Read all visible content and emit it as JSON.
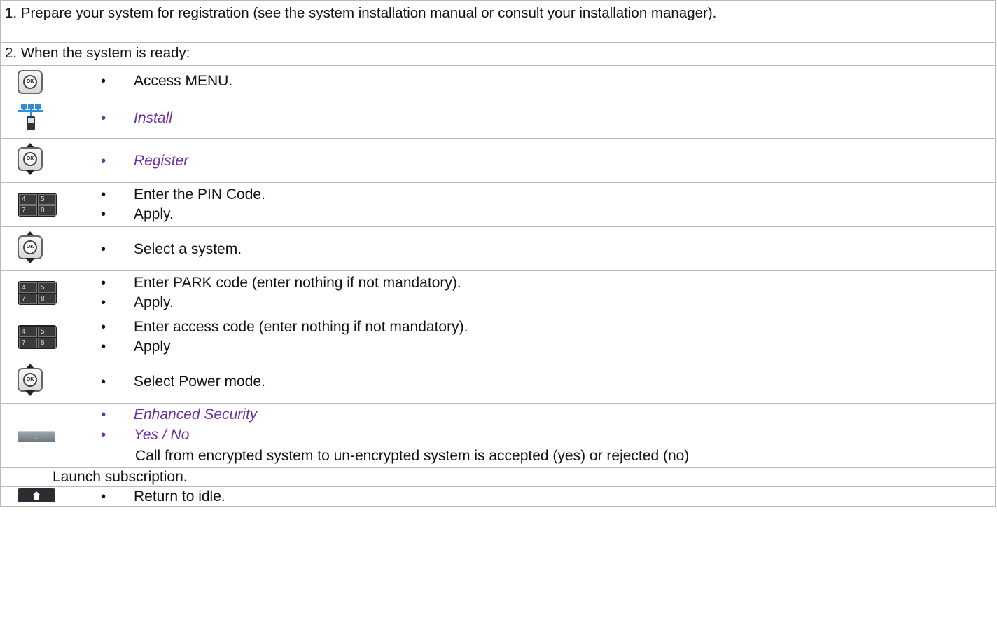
{
  "intro": {
    "step1": "1. Prepare your system for registration (see the system installation manual or consult your installation manager).",
    "step2": "2. When the system is ready:"
  },
  "steps": [
    {
      "icon": "ok-key-icon",
      "items": [
        "Access MENU."
      ]
    },
    {
      "icon": "install-network-icon",
      "items": [
        "Install"
      ]
    },
    {
      "icon": "navigator-ok-key-icon",
      "items": [
        "Register"
      ]
    },
    {
      "icon": "keypad-icon",
      "items": [
        "Enter the PIN Code.",
        "Apply."
      ]
    },
    {
      "icon": "navigator-ok-key-icon",
      "items": [
        "Select a system."
      ]
    },
    {
      "icon": "keypad-icon",
      "items": [
        "Enter PARK code (enter nothing if not mandatory).",
        "Apply."
      ]
    },
    {
      "icon": "keypad-icon",
      "items": [
        "Enter access code (enter nothing if not mandatory).",
        "Apply"
      ]
    },
    {
      "icon": "navigator-ok-key-icon",
      "items": [
        "Select Power mode."
      ]
    },
    {
      "icon": "soft-key-icon",
      "items": [
        "Enhanced Security",
        "Yes / No"
      ],
      "note": "Call from encrypted system to un-encrypted system is accepted (yes) or rejected (no)"
    },
    {
      "text": "Launch subscription."
    },
    {
      "icon": "home-key-icon",
      "items": [
        "Return to idle."
      ]
    }
  ],
  "keypad_labels": [
    "4",
    "5",
    "7",
    "8"
  ],
  "ok_label": "OK",
  "colors": {
    "menu_item": "#7030a0",
    "border": "#b9b9b9",
    "install_icon": "#2d8fd8"
  }
}
